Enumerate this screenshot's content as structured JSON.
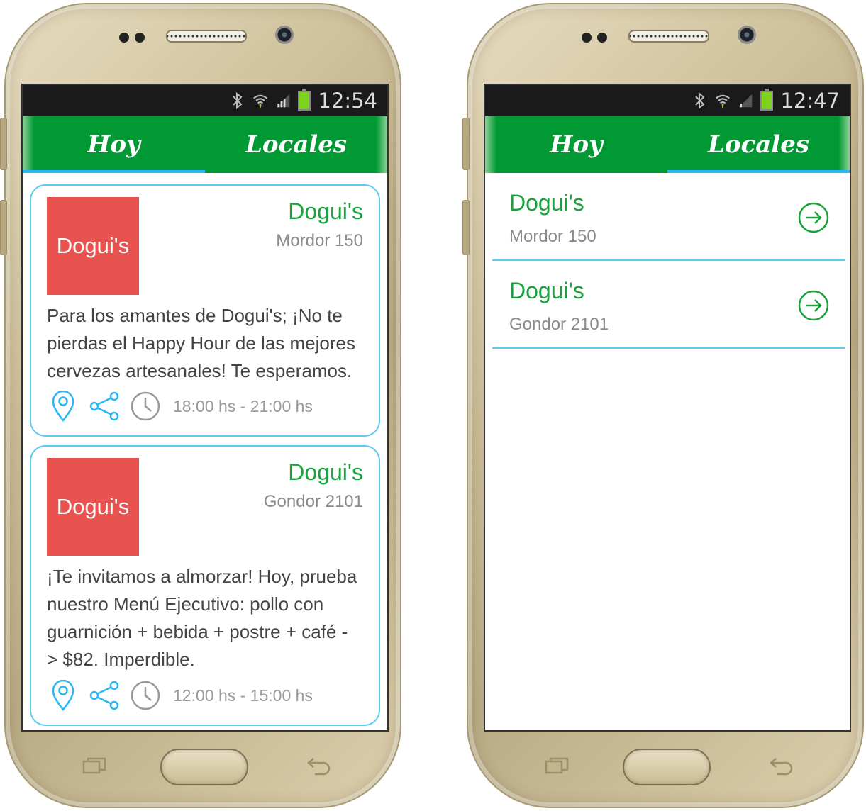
{
  "left_phone": {
    "status": {
      "time": "12:54"
    },
    "tabs": [
      {
        "label": "Hoy",
        "selected": true
      },
      {
        "label": "Locales",
        "selected": false
      }
    ],
    "cards": [
      {
        "logo_text": "Dogui's",
        "name": "Dogui's",
        "address": "Mordor 150",
        "description": "Para los amantes de Dogui's; ¡No te pierdas el Happy Hour de las mejores cervezas artesanales! Te esperamos.",
        "time_range": "18:00 hs - 21:00 hs"
      },
      {
        "logo_text": "Dogui's",
        "name": "Dogui's",
        "address": "Gondor 2101",
        "description": "¡Te invitamos a almorzar! Hoy, prueba nuestro Menú Ejecutivo: pollo con guarnición + bebida + postre + café -> $82. Imperdible.",
        "time_range": "12:00 hs - 15:00 hs"
      }
    ]
  },
  "right_phone": {
    "status": {
      "time": "12:47"
    },
    "tabs": [
      {
        "label": "Hoy",
        "selected": false
      },
      {
        "label": "Locales",
        "selected": true
      }
    ],
    "locales": [
      {
        "name": "Dogui's",
        "address": "Mordor 150"
      },
      {
        "name": "Dogui's",
        "address": "Gondor 2101"
      }
    ]
  },
  "colors": {
    "app_bar": "#009933",
    "tab_indicator": "#29b6f6",
    "accent_green": "#1aa33a",
    "card_border": "#5ccbf0",
    "logo_bg": "#e8524f"
  },
  "icons": [
    "bluetooth-icon",
    "wifi-icon",
    "signal-icon",
    "battery-icon",
    "location-pin-icon",
    "share-icon",
    "clock-icon",
    "arrow-circle-right-icon",
    "recent-apps-icon",
    "back-icon"
  ]
}
